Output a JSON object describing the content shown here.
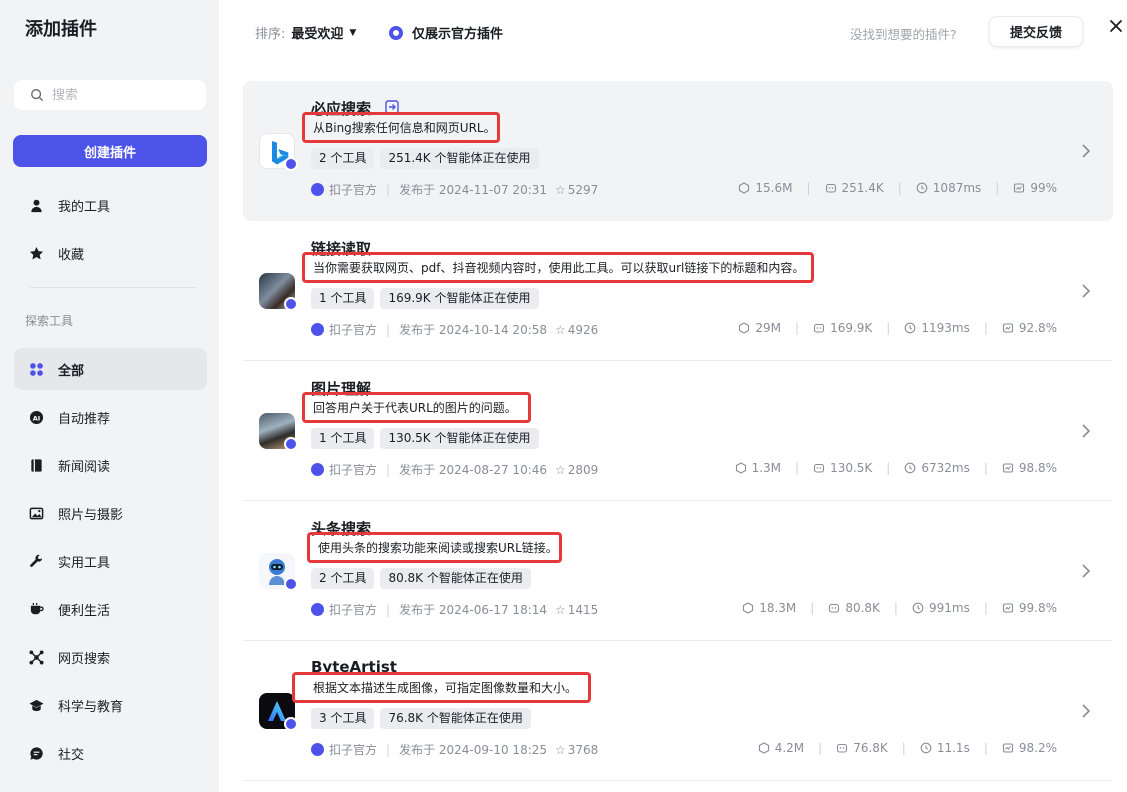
{
  "sidebar": {
    "title": "添加插件",
    "search_placeholder": "搜索",
    "create_label": "创建插件",
    "my_tools": "我的工具",
    "favorites": "收藏",
    "section_label": "探索工具",
    "categories": [
      {
        "label": "全部",
        "icon": "grid-icon",
        "active": true
      },
      {
        "label": "自动推荐",
        "icon": "ai-icon"
      },
      {
        "label": "新闻阅读",
        "icon": "book-icon"
      },
      {
        "label": "照片与摄影",
        "icon": "image-icon"
      },
      {
        "label": "实用工具",
        "icon": "wrench-icon"
      },
      {
        "label": "便利生活",
        "icon": "cup-icon"
      },
      {
        "label": "网页搜索",
        "icon": "network-icon"
      },
      {
        "label": "科学与教育",
        "icon": "graduation-cap-icon"
      },
      {
        "label": "社交",
        "icon": "chat-icon"
      }
    ]
  },
  "topbar": {
    "sort_label": "排序:",
    "sort_value": "最受欢迎",
    "official_only": "仅展示官方插件",
    "feedback_hint": "没找到想要的插件?",
    "feedback_button": "提交反馈"
  },
  "plugins": [
    {
      "name": "必应搜索",
      "desc": "从Bing搜索任何信息和网页URL。",
      "tools": "2 个工具",
      "usage": "251.4K 个智能体正在使用",
      "publisher": "扣子官方",
      "published": "发布于 2024-11-07 20:31",
      "stars": "5297",
      "stats": [
        "15.6M",
        "251.4K",
        "1087ms",
        "99%"
      ]
    },
    {
      "name": "链接读取",
      "desc": "当你需要获取网页、pdf、抖音视频内容时，使用此工具。可以获取url链接下的标题和内容。",
      "tools": "1 个工具",
      "usage": "169.9K 个智能体正在使用",
      "publisher": "扣子官方",
      "published": "发布于 2024-10-14 20:58",
      "stars": "4926",
      "stats": [
        "29M",
        "169.9K",
        "1193ms",
        "92.8%"
      ]
    },
    {
      "name": "图片理解",
      "desc": "回答用户关于代表URL的图片的问题。",
      "tools": "1 个工具",
      "usage": "130.5K 个智能体正在使用",
      "publisher": "扣子官方",
      "published": "发布于 2024-08-27 10:46",
      "stars": "2809",
      "stats": [
        "1.3M",
        "130.5K",
        "6732ms",
        "98.8%"
      ]
    },
    {
      "name": "头条搜索",
      "desc": "使用头条的搜索功能来阅读或搜索URL链接。",
      "tools": "2 个工具",
      "usage": "80.8K 个智能体正在使用",
      "publisher": "扣子官方",
      "published": "发布于 2024-06-17 18:14",
      "stars": "1415",
      "stats": [
        "18.3M",
        "80.8K",
        "991ms",
        "99.8%"
      ]
    },
    {
      "name": "ByteArtist",
      "desc": "根据文本描述生成图像，可指定图像数量和大小。",
      "tools": "3 个工具",
      "usage": "76.8K 个智能体正在使用",
      "publisher": "扣子官方",
      "published": "发布于 2024-09-10 18:25",
      "stars": "3768",
      "stats": [
        "4.2M",
        "76.8K",
        "11.1s",
        "98.2%"
      ]
    }
  ],
  "colors": {
    "accent": "#4d53e8",
    "highlight_border": "#e5383b",
    "sidebar_bg": "#f2f3f5"
  }
}
